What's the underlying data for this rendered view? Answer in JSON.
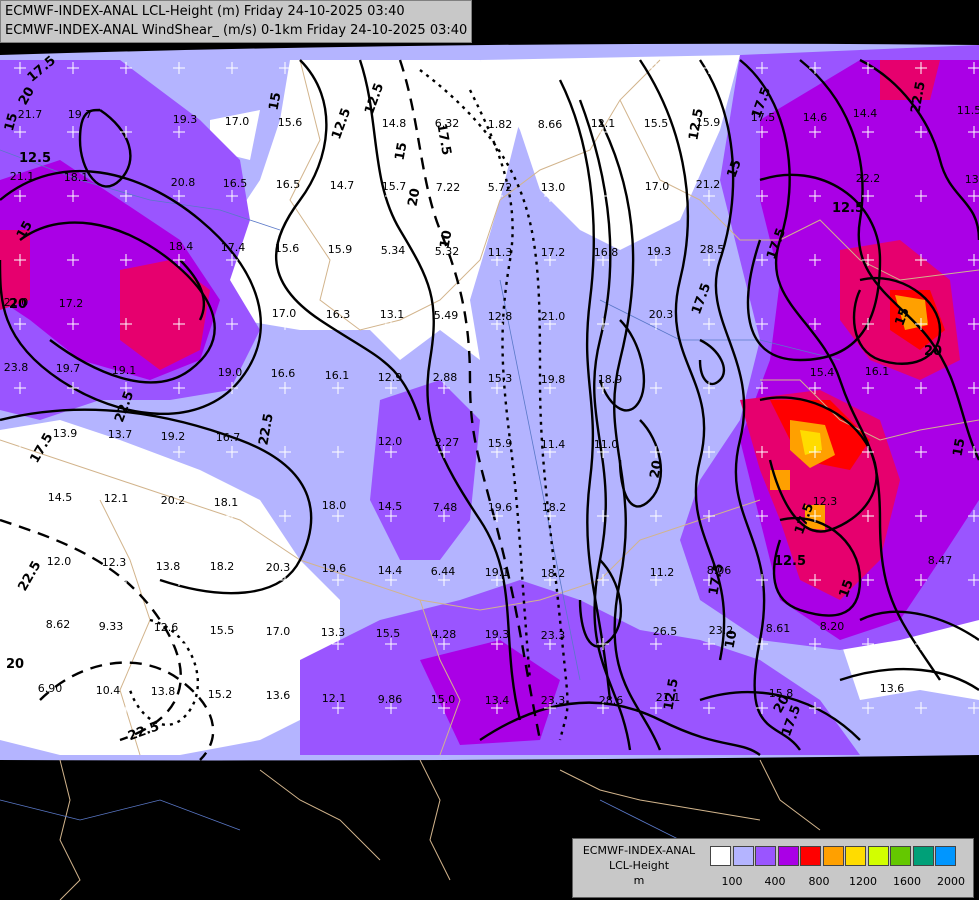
{
  "header": {
    "line1": "ECMWF-INDEX-ANAL LCL-Height (m) Friday 24-10-2025 03:40",
    "line2": "ECMWF-INDEX-ANAL WindShear_ (m/s) 0-1km Friday 24-10-2025 03:40"
  },
  "legend": {
    "model": "ECMWF-INDEX-ANAL",
    "param": "LCL-Height",
    "unit": "m",
    "colors": [
      "#ffffff",
      "#b4b4ff",
      "#9a55ff",
      "#aa00e6",
      "#ff0000",
      "#ffa000",
      "#ffdc00",
      "#d2ff00",
      "#64c800",
      "#00a078",
      "#0096ff"
    ],
    "ticks": [
      "100",
      "400",
      "800",
      "1200",
      "1600",
      "2000"
    ]
  },
  "contour_labels": [
    "17.5",
    "15",
    "12.5",
    "15",
    "17.5",
    "20",
    "12.5",
    "10",
    "17.5",
    "15",
    "12.5",
    "12.5",
    "15",
    "20",
    "22.5",
    "17.5",
    "20",
    "15",
    "12.5",
    "15",
    "20",
    "22.5",
    "22.5",
    "17.5",
    "17.5",
    "20",
    "17.5",
    "12.5",
    "10",
    "12.5",
    "15",
    "15",
    "17.5",
    "20",
    "22.5",
    "20",
    "22.5",
    "17.5"
  ],
  "station_values": [
    "21.7",
    "19.7",
    "19.3",
    "17.0",
    "15.6",
    "14.8",
    "6.32",
    "1.82",
    "8.66",
    "12.1",
    "15.5",
    "15.9",
    "17.5",
    "14.6",
    "14.4",
    "11.5",
    "21.1",
    "18.1",
    "20.8",
    "16.5",
    "16.5",
    "14.7",
    "15.7",
    "7.22",
    "5.72",
    "13.0",
    "17.0",
    "21.2",
    "13.9",
    "22.2",
    "18.4",
    "17.4",
    "15.6",
    "15.9",
    "5.34",
    "5.32",
    "11.3",
    "17.2",
    "16.8",
    "19.3",
    "28.5",
    "21.0",
    "17.2",
    "17.0",
    "16.3",
    "13.1",
    "5.49",
    "12.8",
    "21.0",
    "20.3",
    "23.8",
    "19.7",
    "19.1",
    "19.0",
    "16.6",
    "16.1",
    "12.9",
    "2.88",
    "15.3",
    "19.8",
    "18.9",
    "15.4",
    "16.1",
    "13.9",
    "13.7",
    "19.2",
    "16.7",
    "12.0",
    "2.27",
    "15.9",
    "11.4",
    "11.0",
    "14.5",
    "12.1",
    "20.2",
    "18.1",
    "18.0",
    "14.5",
    "7.48",
    "19.6",
    "18.2",
    "12.3",
    "8.47",
    "12.0",
    "12.3",
    "13.8",
    "18.2",
    "20.3",
    "19.6",
    "14.4",
    "6.44",
    "19.1",
    "18.2",
    "11.2",
    "8.06",
    "8.62",
    "9.33",
    "12.6",
    "15.5",
    "17.0",
    "13.3",
    "15.5",
    "4.28",
    "19.3",
    "23.3",
    "26.5",
    "23.2",
    "8.61",
    "8.20",
    "6.90",
    "10.4",
    "13.8",
    "15.2",
    "13.6",
    "12.1",
    "9.86",
    "15.0",
    "13.4",
    "23.3",
    "28.6",
    "21.1",
    "15.8",
    "13.6"
  ]
}
